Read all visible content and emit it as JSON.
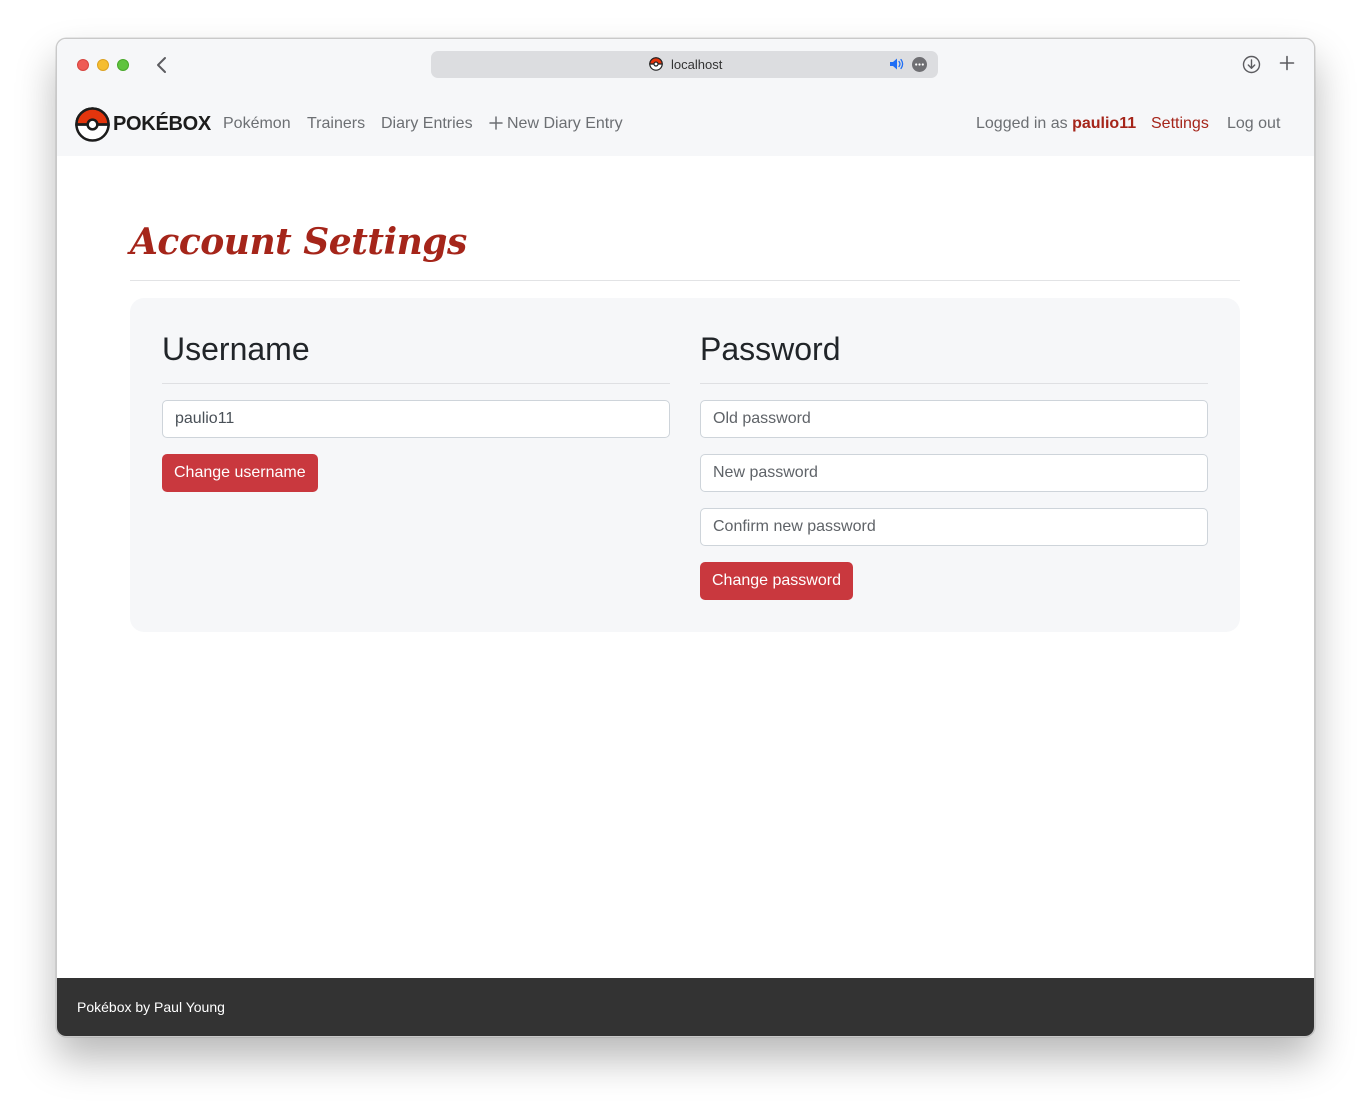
{
  "browser": {
    "url": "localhost"
  },
  "navbar": {
    "brand": "POKÉBOX",
    "links": [
      {
        "label": "Pokémon"
      },
      {
        "label": "Trainers"
      },
      {
        "label": "Diary Entries"
      },
      {
        "label": "New Diary Entry"
      }
    ],
    "logged_in_prefix": "Logged in as",
    "username": "paulio11",
    "settings_label": "Settings",
    "logout_label": "Log out"
  },
  "page": {
    "title": "Account Settings"
  },
  "username_section": {
    "heading": "Username",
    "input_value": "paulio11",
    "button_label": "Change username"
  },
  "password_section": {
    "heading": "Password",
    "old_placeholder": "Old password",
    "new_placeholder": "New password",
    "confirm_placeholder": "Confirm new password",
    "button_label": "Change password"
  },
  "footer": {
    "text": "Pokébox by Paul Young"
  },
  "colors": {
    "accent": "#a5251a",
    "button": "#c9383e",
    "footer_bg": "#333333"
  }
}
